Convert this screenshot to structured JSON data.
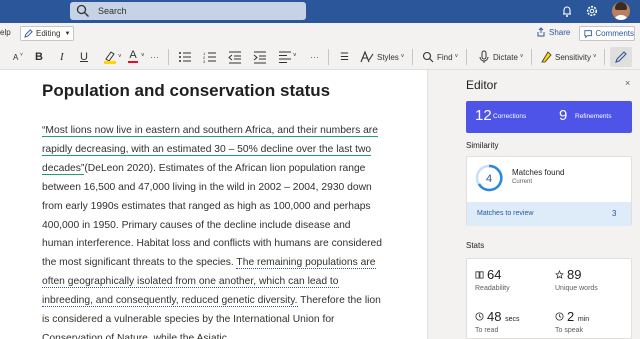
{
  "header": {
    "search_placeholder": "Search"
  },
  "menu": {
    "help_label": "elp",
    "editing_label": "Editing",
    "share_label": "Share",
    "comments_label": "Comments"
  },
  "ribbon": {
    "font_size_glyph": "A",
    "bold": "B",
    "italic": "I",
    "underline": "U",
    "font_color": "A",
    "styles_label": "Styles",
    "find_label": "Find",
    "dictate_label": "Dictate",
    "sensitivity_label": "Sensitivity",
    "highlight_color": "#ffd600",
    "font_color_bar": "#e81123"
  },
  "document": {
    "title": "Population and conservation status",
    "segments": [
      {
        "text": "“Most lions now live in eastern and southern Africa, and their numbers are rapidly decreasing, with an estimated 30 – 50% decline over the last two decades”",
        "style": "green"
      },
      {
        "text": "(DeLeon 2020). Estimates of the African lion population range between 16,500 and 47,000 living in the wild in 2002 – 2004, 2930 down from early 1990s estimates that ranged as high as 100,000 and perhaps 400,000 in 1950. Primary causes of the decline include disease and human interference. Habitat loss and conflicts with humans are considered the most significant threats to the species. ",
        "style": "plain"
      },
      {
        "text": "The remaining populations are often geographically isolated from one another, which can lead to inbreeding, and consequently, reduced genetic diversity.",
        "style": "blue"
      },
      {
        "text": " Therefore the lion is considered a vulnerable species by the International Union for Conservation of Nature, while the Asiatic",
        "style": "plain"
      }
    ]
  },
  "editor_pane": {
    "title": "Editor",
    "close_glyph": "×",
    "corrections_count": "12",
    "corrections_label": "Corrections",
    "refinements_count": "9",
    "refinements_label": "Refinements",
    "similarity_heading": "Similarity",
    "matches_count": "4",
    "matches_found_label": "Matches found",
    "current_label": "Current",
    "matches_to_review_label": "Matches to review",
    "matches_to_review_count": "3",
    "stats_heading": "Stats",
    "stats": {
      "readability_value": "64",
      "readability_label": "Readability",
      "unique_words_value": "89",
      "unique_words_label": "Unique words",
      "to_read_value": "48",
      "to_read_unit": "secs",
      "to_read_label": "To read",
      "to_speak_value": "2",
      "to_speak_unit": "min",
      "to_speak_label": "To speak"
    },
    "accent_color": "#4f54e8",
    "ring_color": "#2b88d8"
  }
}
